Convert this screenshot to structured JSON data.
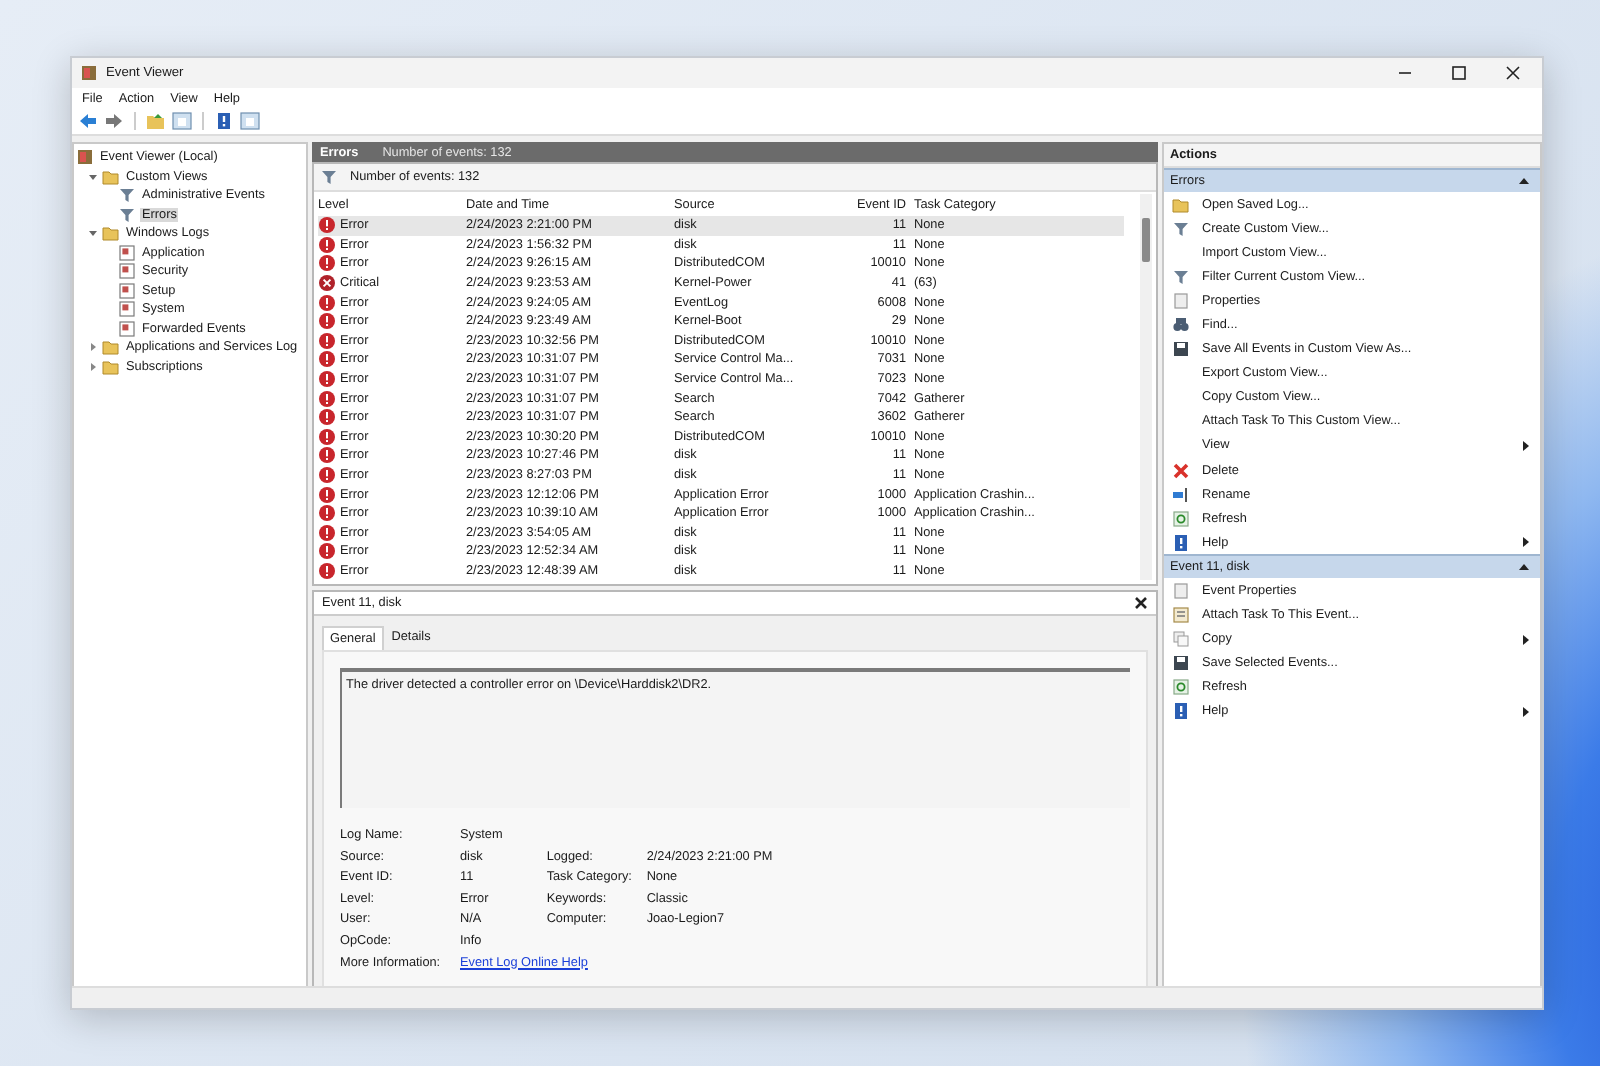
{
  "window": {
    "title": "Event Viewer"
  },
  "menu": [
    "File",
    "Action",
    "View",
    "Help"
  ],
  "tree": [
    {
      "label": "Event Viewer (Local)",
      "kind": "root",
      "selected": false,
      "children": [
        {
          "label": "Custom Views",
          "kind": "folder",
          "expanded": true,
          "selected": false,
          "children": [
            {
              "label": "Administrative Events",
              "kind": "filter",
              "selected": false
            },
            {
              "label": "Errors",
              "kind": "filter",
              "selected": true
            }
          ]
        },
        {
          "label": "Windows Logs",
          "kind": "folder",
          "expanded": true,
          "selected": false,
          "children": [
            {
              "label": "Application",
              "kind": "log",
              "selected": false
            },
            {
              "label": "Security",
              "kind": "log",
              "selected": false
            },
            {
              "label": "Setup",
              "kind": "log",
              "selected": false
            },
            {
              "label": "System",
              "kind": "log",
              "selected": false
            },
            {
              "label": "Forwarded Events",
              "kind": "log",
              "selected": false
            }
          ]
        },
        {
          "label": "Applications and Services Log",
          "kind": "folder",
          "expanded": false,
          "selected": false
        },
        {
          "label": "Subscriptions",
          "kind": "folder",
          "expanded": false,
          "selected": false
        }
      ]
    }
  ],
  "header": {
    "title": "Errors",
    "count": "Number of events: 132"
  },
  "filter_bar": {
    "text": "Number of events: 132"
  },
  "table": {
    "columns": [
      "Level",
      "Date and Time",
      "Source",
      "Event ID",
      "Task Category"
    ],
    "rows": [
      {
        "kind": "error",
        "level": "Error",
        "date": "2/24/2023 2:21:00 PM",
        "source": "disk",
        "event_id": "11",
        "category": "None",
        "selected": true
      },
      {
        "kind": "error",
        "level": "Error",
        "date": "2/24/2023 1:56:32 PM",
        "source": "disk",
        "event_id": "11",
        "category": "None",
        "selected": false
      },
      {
        "kind": "error",
        "level": "Error",
        "date": "2/24/2023 9:26:15 AM",
        "source": "DistributedCOM",
        "event_id": "10010",
        "category": "None",
        "selected": false
      },
      {
        "kind": "critical",
        "level": "Critical",
        "date": "2/24/2023 9:23:53 AM",
        "source": "Kernel-Power",
        "event_id": "41",
        "category": "(63)",
        "selected": false
      },
      {
        "kind": "error",
        "level": "Error",
        "date": "2/24/2023 9:24:05 AM",
        "source": "EventLog",
        "event_id": "6008",
        "category": "None",
        "selected": false
      },
      {
        "kind": "error",
        "level": "Error",
        "date": "2/24/2023 9:23:49 AM",
        "source": "Kernel-Boot",
        "event_id": "29",
        "category": "None",
        "selected": false
      },
      {
        "kind": "error",
        "level": "Error",
        "date": "2/23/2023 10:32:56 PM",
        "source": "DistributedCOM",
        "event_id": "10010",
        "category": "None",
        "selected": false
      },
      {
        "kind": "error",
        "level": "Error",
        "date": "2/23/2023 10:31:07 PM",
        "source": "Service Control Ma...",
        "event_id": "7031",
        "category": "None",
        "selected": false
      },
      {
        "kind": "error",
        "level": "Error",
        "date": "2/23/2023 10:31:07 PM",
        "source": "Service Control Ma...",
        "event_id": "7023",
        "category": "None",
        "selected": false
      },
      {
        "kind": "error",
        "level": "Error",
        "date": "2/23/2023 10:31:07 PM",
        "source": "Search",
        "event_id": "7042",
        "category": "Gatherer",
        "selected": false
      },
      {
        "kind": "error",
        "level": "Error",
        "date": "2/23/2023 10:31:07 PM",
        "source": "Search",
        "event_id": "3602",
        "category": "Gatherer",
        "selected": false
      },
      {
        "kind": "error",
        "level": "Error",
        "date": "2/23/2023 10:30:20 PM",
        "source": "DistributedCOM",
        "event_id": "10010",
        "category": "None",
        "selected": false
      },
      {
        "kind": "error",
        "level": "Error",
        "date": "2/23/2023 10:27:46 PM",
        "source": "disk",
        "event_id": "11",
        "category": "None",
        "selected": false
      },
      {
        "kind": "error",
        "level": "Error",
        "date": "2/23/2023 8:27:03 PM",
        "source": "disk",
        "event_id": "11",
        "category": "None",
        "selected": false
      },
      {
        "kind": "error",
        "level": "Error",
        "date": "2/23/2023 12:12:06 PM",
        "source": "Application Error",
        "event_id": "1000",
        "category": "Application Crashin...",
        "selected": false
      },
      {
        "kind": "error",
        "level": "Error",
        "date": "2/23/2023 10:39:10 AM",
        "source": "Application Error",
        "event_id": "1000",
        "category": "Application Crashin...",
        "selected": false
      },
      {
        "kind": "error",
        "level": "Error",
        "date": "2/23/2023 3:54:05 AM",
        "source": "disk",
        "event_id": "11",
        "category": "None",
        "selected": false
      },
      {
        "kind": "error",
        "level": "Error",
        "date": "2/23/2023 12:52:34 AM",
        "source": "disk",
        "event_id": "11",
        "category": "None",
        "selected": false
      },
      {
        "kind": "error",
        "level": "Error",
        "date": "2/23/2023 12:48:39 AM",
        "source": "disk",
        "event_id": "11",
        "category": "None",
        "selected": false
      }
    ]
  },
  "detail": {
    "title": "Event 11, disk",
    "tabs": [
      {
        "label": "General",
        "selected": true
      },
      {
        "label": "Details",
        "selected": false
      }
    ],
    "message": "The driver detected a controller error on \\Device\\Harddisk2\\DR2.",
    "left_fields": [
      {
        "label": "Log Name:",
        "value": "System"
      },
      {
        "label": "Source:",
        "value": "disk"
      },
      {
        "label": "Event ID:",
        "value": "11"
      },
      {
        "label": "Level:",
        "value": "Error"
      },
      {
        "label": "User:",
        "value": "N/A"
      },
      {
        "label": "OpCode:",
        "value": "Info"
      }
    ],
    "right_fields": [
      {
        "label": "Logged:",
        "value": "2/24/2023 2:21:00 PM"
      },
      {
        "label": "Task Category:",
        "value": "None"
      },
      {
        "label": "Keywords:",
        "value": "Classic"
      },
      {
        "label": "Computer:",
        "value": "Joao-Legion7"
      }
    ],
    "more_info": {
      "label": "More Information:",
      "link": "Event Log Online Help"
    }
  },
  "actions": {
    "title": "Actions",
    "sections": [
      {
        "title": "Errors",
        "items": [
          {
            "label": "Open Saved Log...",
            "kind": "folder",
            "submenu": false
          },
          {
            "label": "Create Custom View...",
            "kind": "filter",
            "submenu": false
          },
          {
            "label": "Import Custom View...",
            "kind": "none",
            "submenu": false
          },
          {
            "label": "Filter Current Custom View...",
            "kind": "filter",
            "submenu": false
          },
          {
            "label": "Properties",
            "kind": "page",
            "submenu": false
          },
          {
            "label": "Find...",
            "kind": "binoculars",
            "submenu": false
          },
          {
            "label": "Save All Events in Custom View As...",
            "kind": "disk",
            "submenu": false
          },
          {
            "label": "Export Custom View...",
            "kind": "none",
            "submenu": false
          },
          {
            "label": "Copy Custom View...",
            "kind": "none",
            "submenu": false
          },
          {
            "label": "Attach Task To This Custom View...",
            "kind": "none",
            "submenu": false
          },
          {
            "label": "View",
            "kind": "none",
            "submenu": true
          },
          {
            "label": "Delete",
            "kind": "delete",
            "submenu": false
          },
          {
            "label": "Rename",
            "kind": "rename",
            "submenu": false
          },
          {
            "label": "Refresh",
            "kind": "refresh",
            "submenu": false
          },
          {
            "label": "Help",
            "kind": "help",
            "submenu": true
          }
        ]
      },
      {
        "title": "Event 11, disk",
        "items": [
          {
            "label": "Event Properties",
            "kind": "page",
            "submenu": false
          },
          {
            "label": "Attach Task To This Event...",
            "kind": "task",
            "submenu": false
          },
          {
            "label": "Copy",
            "kind": "copy",
            "submenu": true
          },
          {
            "label": "Save Selected Events...",
            "kind": "disk",
            "submenu": false
          },
          {
            "label": "Refresh",
            "kind": "refresh",
            "submenu": false
          },
          {
            "label": "Help",
            "kind": "help",
            "submenu": true
          }
        ]
      }
    ]
  }
}
